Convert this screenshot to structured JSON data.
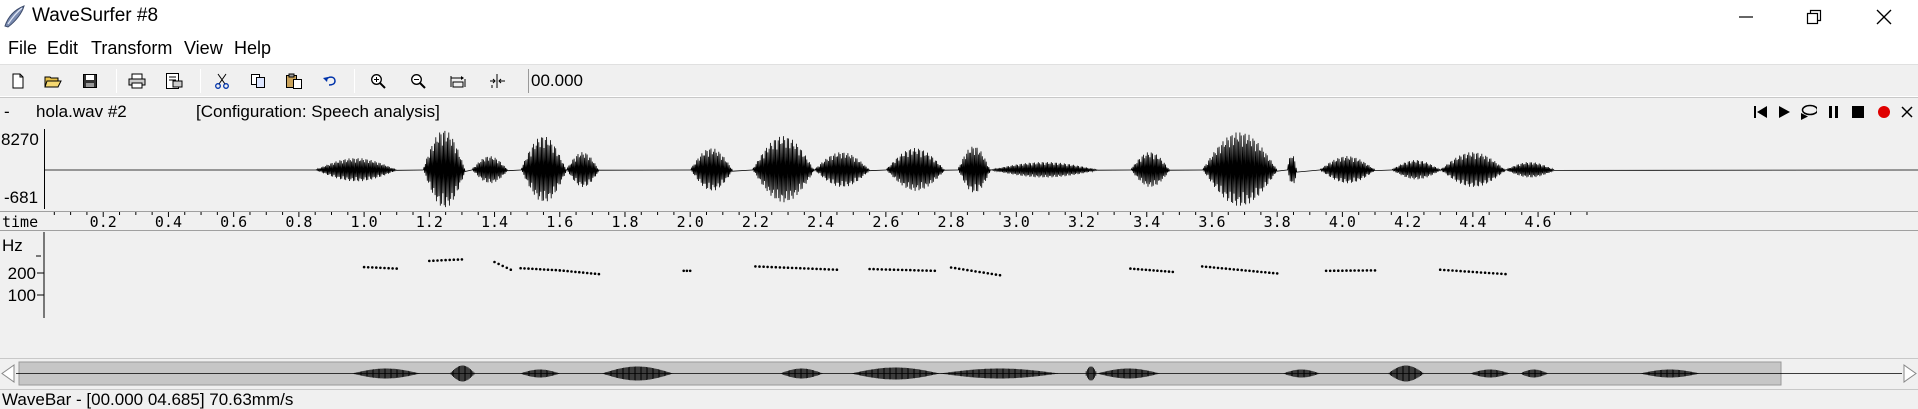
{
  "window": {
    "title": "WaveSurfer #8"
  },
  "menu": [
    "File",
    "Edit",
    "Transform",
    "View",
    "Help"
  ],
  "toolbar": {
    "buttons": [
      "new-file",
      "open-folder",
      "save",
      "print",
      "print-setup",
      "cut",
      "copy",
      "paste",
      "undo",
      "zoom-in",
      "zoom-out",
      "zoom-full",
      "zoom-selection"
    ],
    "time_value": "00.000"
  },
  "sound": {
    "dash": "-",
    "filename": "hola.wav #2",
    "configuration": "[Configuration: Speech analysis]",
    "playback_buttons": [
      "skip-to-start",
      "play",
      "play-loop",
      "pause",
      "stop",
      "record",
      "close"
    ]
  },
  "waveform": {
    "max_label": "8270",
    "min_label": "-681"
  },
  "time_axis": {
    "label": "time",
    "ticks": [
      "0.2",
      "0.4",
      "0.6",
      "0.8",
      "1.0",
      "1.2",
      "1.4",
      "1.6",
      "1.8",
      "2.0",
      "2.2",
      "2.4",
      "2.6",
      "2.8",
      "3.0",
      "3.2",
      "3.4",
      "3.6",
      "3.8",
      "4.0",
      "4.2",
      "4.4",
      "4.6"
    ]
  },
  "pitch": {
    "unit_label": "Hz",
    "ticks": [
      "200",
      "100"
    ],
    "segments": [
      [
        1.0,
        1.1,
        227,
        220
      ],
      [
        1.2,
        1.3,
        255,
        262
      ],
      [
        1.4,
        1.45,
        250,
        215
      ],
      [
        1.48,
        1.6,
        222,
        212
      ],
      [
        1.6,
        1.72,
        212,
        195
      ],
      [
        1.98,
        2.0,
        210,
        210
      ],
      [
        2.2,
        2.45,
        230,
        215
      ],
      [
        2.55,
        2.75,
        218,
        210
      ],
      [
        2.8,
        2.95,
        225,
        190
      ],
      [
        3.35,
        3.48,
        220,
        205
      ],
      [
        3.57,
        3.8,
        230,
        198
      ],
      [
        3.95,
        4.1,
        210,
        212
      ],
      [
        4.3,
        4.5,
        215,
        195
      ]
    ]
  },
  "colors": {
    "record": "#e00000",
    "accent": "#000000"
  },
  "wavebar": {
    "status": "WaveBar - [00.000 04.685] 70.63mm/s"
  }
}
